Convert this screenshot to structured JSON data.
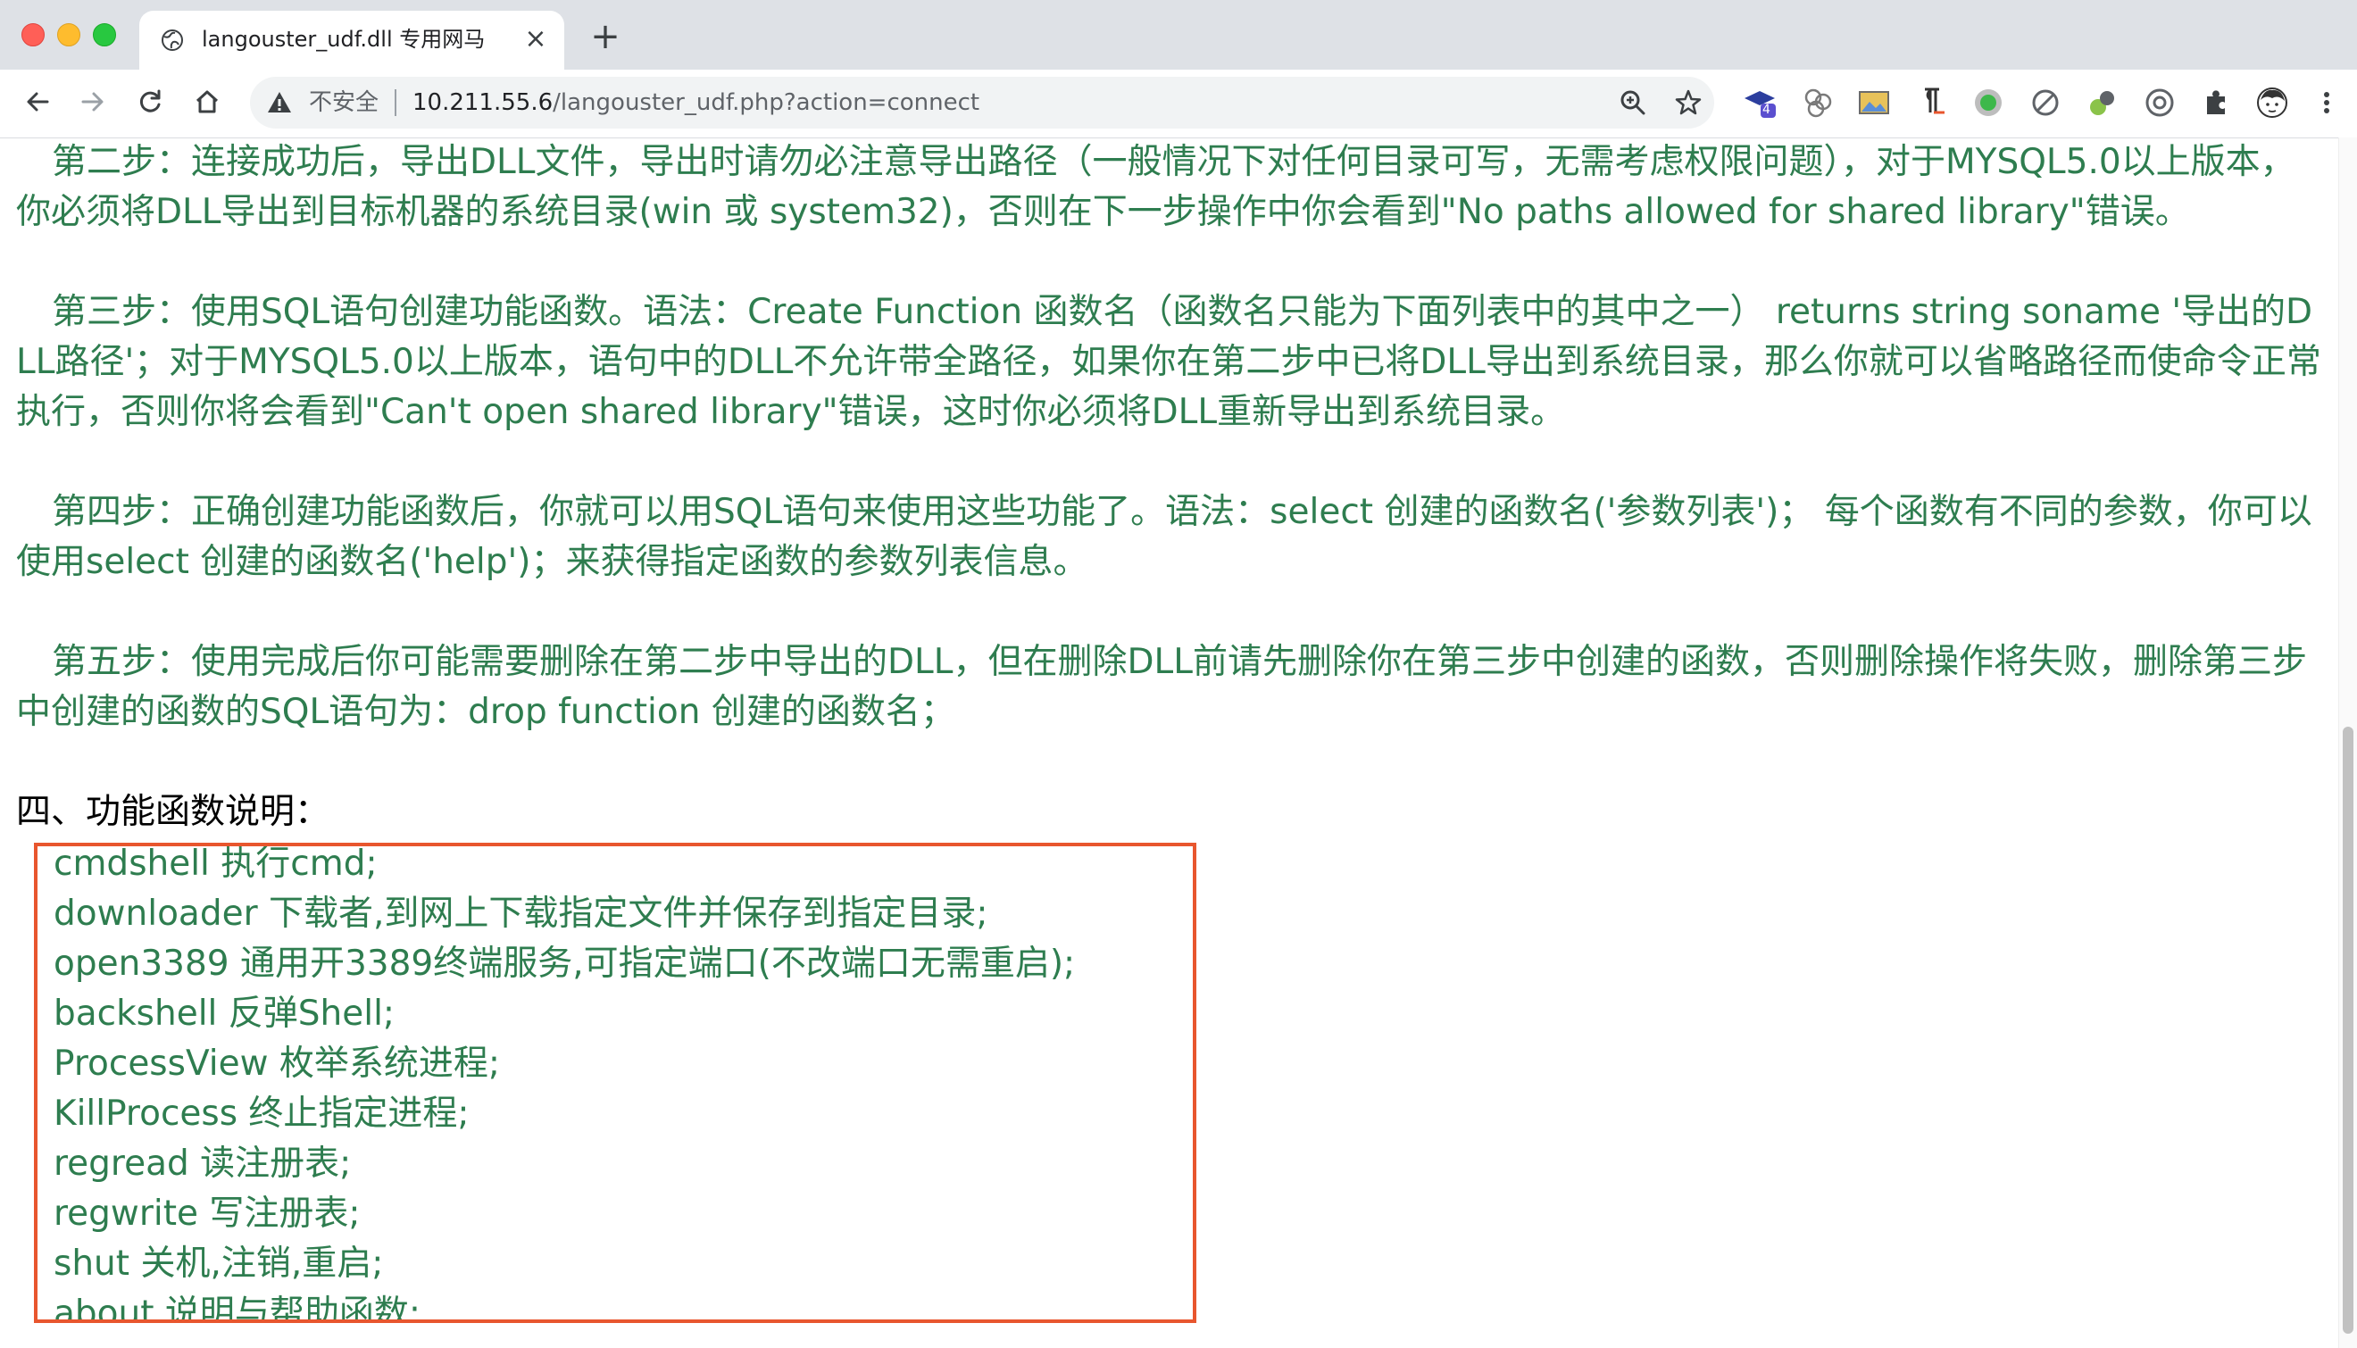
{
  "browser": {
    "tab_title": "langouster_udf.dll 专用网马",
    "tab_close": "×",
    "new_tab": "+",
    "security_label": "不安全",
    "url_host": "10.211.55.6",
    "url_path": "/langouster_udf.php?action=connect",
    "extension_badge": "4",
    "icons": [
      "back-icon",
      "forward-icon",
      "reload-icon",
      "home-icon",
      "warning-icon",
      "zoom-icon",
      "star-icon",
      "extensions-icon",
      "menu-icon"
    ]
  },
  "content": {
    "step2": "第二步：连接成功后，导出DLL文件，导出时请勿必注意导出路径（一般情况下对任何目录可写，无需考虑权限问题），对于MYSQL5.0以上版本，你必须将DLL导出到目标机器的系统目录(win 或 system32)，否则在下一步操作中你会看到\"No paths allowed for shared library\"错误。",
    "step3": "第三步：使用SQL语句创建功能函数。语法：Create Function 函数名（函数名只能为下面列表中的其中之一） returns string soname '导出的DLL路径'；对于MYSQL5.0以上版本，语句中的DLL不允许带全路径，如果你在第二步中已将DLL导出到系统目录，那么你就可以省略路径而使命令正常执行，否则你将会看到\"Can't open shared library\"错误，这时你必须将DLL重新导出到系统目录。",
    "step4": "第四步：正确创建功能函数后，你就可以用SQL语句来使用这些功能了。语法：select 创建的函数名('参数列表')； 每个函数有不同的参数，你可以使用select 创建的函数名('help')；来获得指定函数的参数列表信息。",
    "step5": "第五步：使用完成后你可能需要删除在第二步中导出的DLL，但在删除DLL前请先删除你在第三步中创建的函数，否则删除操作将失败，删除第三步中创建的函数的SQL语句为：drop function 创建的函数名；",
    "section_title": "四、功能函数说明：",
    "functions": [
      "cmdshell 执行cmd;",
      "downloader 下载者,到网上下载指定文件并保存到指定目录;",
      "open3389 通用开3389终端服务,可指定端口(不改端口无需重启);",
      "backshell 反弹Shell;",
      "ProcessView 枚举系统进程;",
      "KillProcess 终止指定进程;",
      "regread 读注册表;",
      "regwrite 写注册表;",
      "shut 关机,注销,重启;",
      "about 说明与帮助函数;"
    ]
  },
  "colors": {
    "text_green": "#2e7d4f",
    "box_border": "#e8562e"
  }
}
